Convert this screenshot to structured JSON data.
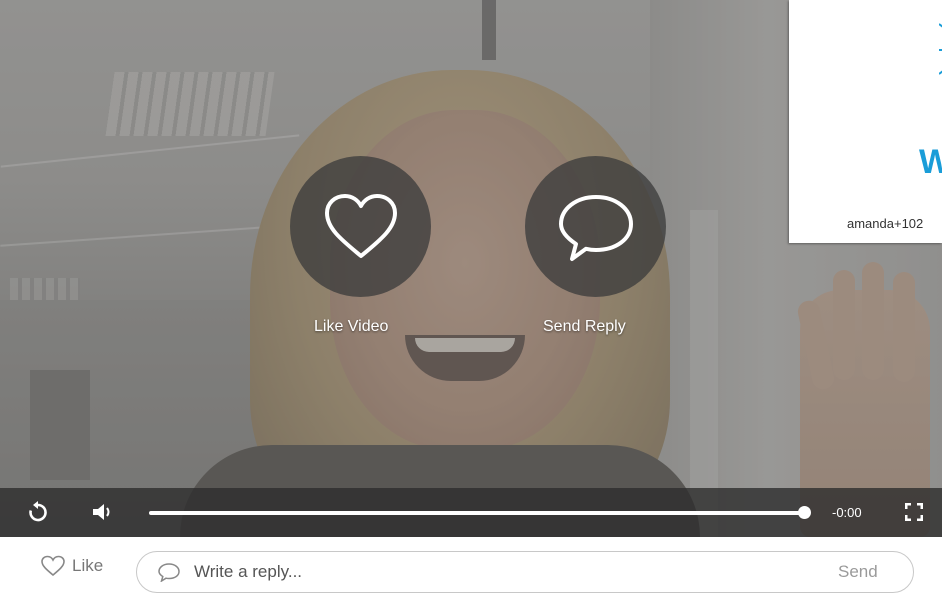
{
  "video": {
    "actions": {
      "like_label": "Like Video",
      "reply_label": "Send Reply"
    },
    "inset": {
      "caption": "amanda+102",
      "partial_letter": "W"
    },
    "controls": {
      "time_remaining": "-0:00",
      "progress": 1.0
    }
  },
  "reply_bar": {
    "like_label": "Like",
    "input_placeholder": "Write a reply...",
    "send_label": "Send"
  },
  "icons": [
    "heart-icon",
    "speech-bubble-icon",
    "replay-icon",
    "volume-icon",
    "fullscreen-icon"
  ],
  "colors": {
    "control_bar": "#2d2d2d",
    "action_circle": "#3c3c3c",
    "brand_blue": "#1a9dd8",
    "muted_text": "#777777"
  }
}
